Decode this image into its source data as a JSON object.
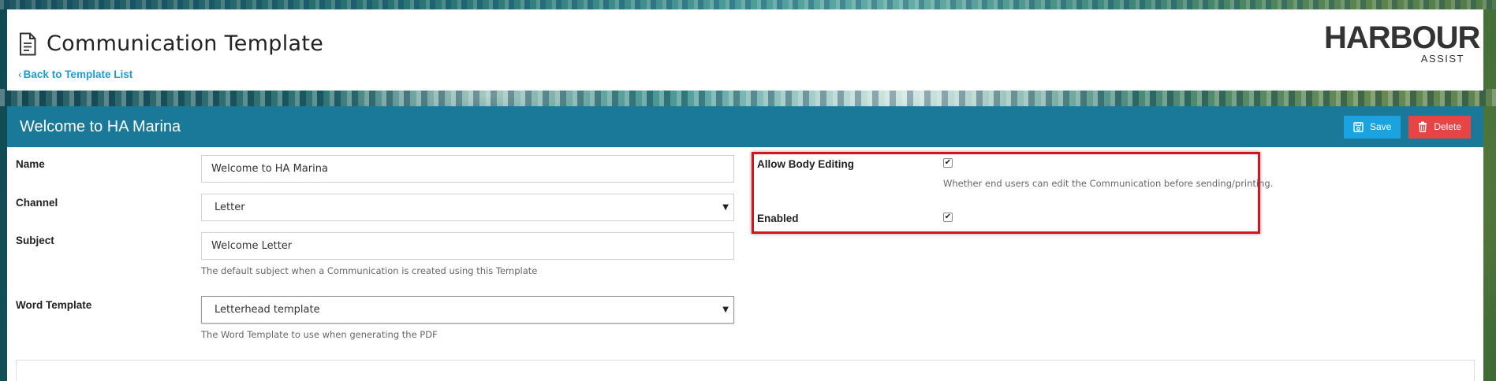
{
  "header": {
    "title": "Communication Template",
    "back_link": "Back to Template List",
    "logo_main": "HARBOUR",
    "logo_sub": "ASSIST"
  },
  "panel": {
    "title": "Welcome to HA Marina",
    "save_label": "Save",
    "delete_label": "Delete"
  },
  "form": {
    "name": {
      "label": "Name",
      "value": "Welcome to HA Marina"
    },
    "channel": {
      "label": "Channel",
      "value": "Letter"
    },
    "subject": {
      "label": "Subject",
      "value": "Welcome Letter",
      "help": "The default subject when a Communication is created using this Template"
    },
    "word_template": {
      "label": "Word Template",
      "value": "Letterhead template",
      "help": "The Word Template to use when generating the PDF"
    },
    "allow_body_editing": {
      "label": "Allow Body Editing",
      "checked": true,
      "help": "Whether end users can edit the Communication before sending/printing."
    },
    "enabled": {
      "label": "Enabled",
      "checked": true
    }
  },
  "colors": {
    "panel_header": "#1a7899",
    "save_button": "#1aa3e0",
    "delete_button": "#e74545",
    "link": "#1d9bd6",
    "highlight": "#d5151c"
  },
  "icons": {
    "title": "document-icon",
    "back": "chevron-left-icon",
    "save": "save-icon",
    "delete": "trash-icon"
  }
}
